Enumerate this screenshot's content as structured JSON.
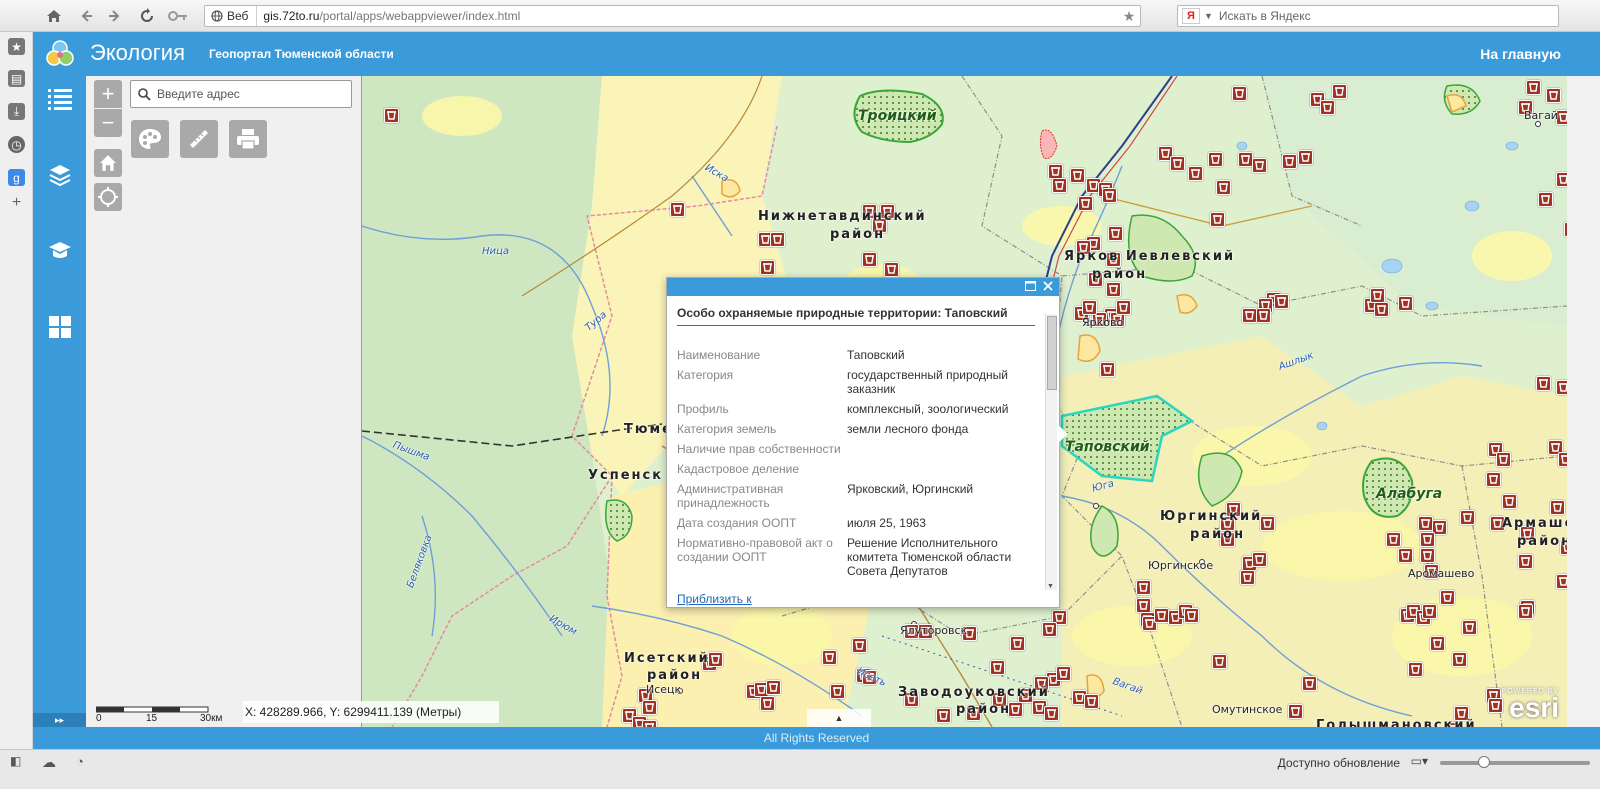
{
  "browser": {
    "address_scheme": "Веб",
    "url_domain": "gis.72to.ru",
    "url_path": "/portal/apps/webappviewer/index.html",
    "search_placeholder": "Искать в Яндекс"
  },
  "app": {
    "title": "Экология",
    "subtitle": "Геопортал Тюменской области",
    "home_link": "На главную",
    "accent_color": "#3b9ad9"
  },
  "map_tools": {
    "zoom_in": "+",
    "zoom_out": "−",
    "address_placeholder": "Введите адрес"
  },
  "scale": {
    "labels": [
      "0",
      "15",
      "30км"
    ]
  },
  "coordinates": "X: 428289.966, Y: 6299411.139 (Метры)",
  "map_labels": {
    "troitsky": "Троицкий",
    "nizhnetavdinsky": "Нижнетавдинский",
    "raion1": "район",
    "yarkovsky_ievlevsky": "Ярков Иевлевский",
    "raion2": "район",
    "tapovsky": "Таповский",
    "alabuga": "Алабуга",
    "yurginsky": "Юргинский",
    "raion3": "район",
    "aromashevsky": "Армашевский",
    "raion4": "район",
    "isetsky": "Исетский",
    "raion5": "район",
    "zavodoukovsky": "Заводоуковский",
    "raion6": "район",
    "golyshmanovsky": "Голышмановский",
    "tyumen": "Тюмен",
    "uspensk": "Успенск",
    "vagai": "Вагай",
    "aromashevo": "Аромашево",
    "yurgino": "Юргинское",
    "omutinskoe": "Омутинское",
    "yalutorovsk": "Ялуторовск",
    "isetskoe": "Исецк",
    "yarkovo": "Ярково",
    "river_nitsa": "Ница",
    "river_pyshma": "Пышма",
    "river_tura": "Тура",
    "river_iset": "Исеть",
    "river_irium": "Ирюм",
    "river_belyakovka": "Беляковка",
    "river_ashlyk": "Ашлык",
    "river_vagai": "Вагай",
    "river_yuga": "Юга",
    "river_iska": "Иска"
  },
  "popup": {
    "title": "Особо охраняемые природные территории: Таповский",
    "rows": [
      {
        "key": "Наименование",
        "value": "Таповский"
      },
      {
        "key": "Категория",
        "value": "государственный природный заказник"
      },
      {
        "key": "Профиль",
        "value": "комплексный, зоологический"
      },
      {
        "key": "Категория земель",
        "value": "земли лесного фонда"
      },
      {
        "key": "Наличие прав собственности",
        "value": ""
      },
      {
        "key": "Кадастровое деление",
        "value": ""
      },
      {
        "key": "Административная принадлежность",
        "value": "Ярковский, Юргинский"
      },
      {
        "key": "Дата создания ООПТ",
        "value": "июля 25, 1963"
      },
      {
        "key": "Нормативно-правовой акт о создании ООПТ",
        "value": "Решение Исполнительного комитета Тюменской области Совета Депутатов"
      }
    ],
    "zoom_link": "Приблизить к"
  },
  "footer": {
    "rights": "All Rights Reserved",
    "powered_by": "POWERED BY",
    "esri": "esri"
  },
  "statusbar": {
    "update_text": "Доступно обновление"
  }
}
